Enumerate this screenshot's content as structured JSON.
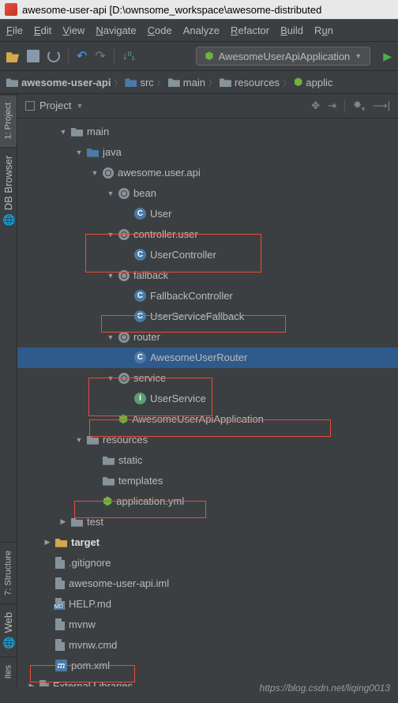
{
  "title": "awesome-user-api [D:\\ownsome_workspace\\awesome-distributed",
  "menu": {
    "file": "File",
    "edit": "Edit",
    "view": "View",
    "navigate": "Navigate",
    "code": "Code",
    "analyze": "Analyze",
    "refactor": "Refactor",
    "build": "Build",
    "run": "Run"
  },
  "runConfig": "AwesomeUserApiApplication",
  "breadcrumb": {
    "root": "awesome-user-api",
    "src": "src",
    "main": "main",
    "resources": "resources",
    "app": "applic"
  },
  "panel": {
    "title": "Project"
  },
  "sidetabs": {
    "project": "1: Project",
    "db": "DB Browser",
    "structure": "7: Structure",
    "web": "Web",
    "fav": "ites"
  },
  "tree": {
    "main": "main",
    "java": "java",
    "pkg": "awesome.user.api",
    "bean": "bean",
    "user": "User",
    "controllerUser": "controller.user",
    "userController": "UserController",
    "fallback": "fallback",
    "fallbackController": "FallbackController",
    "userServiceFallback": "UserServiceFallback",
    "router": "router",
    "awesomeUserRouter": "AwesomeUserRouter",
    "service": "service",
    "userService": "UserService",
    "app": "AwesomeUserApiApplication",
    "resources": "resources",
    "static": "static",
    "templates": "templates",
    "appYml": "application.yml",
    "test": "test",
    "target": "target",
    "gitignore": ".gitignore",
    "iml": "awesome-user-api.iml",
    "help": "HELP.md",
    "mvnw": "mvnw",
    "mvnwCmd": "mvnw.cmd",
    "pom": "pom.xml",
    "ext": "External Libraries"
  },
  "watermark": "https://blog.csdn.net/liqing0013"
}
